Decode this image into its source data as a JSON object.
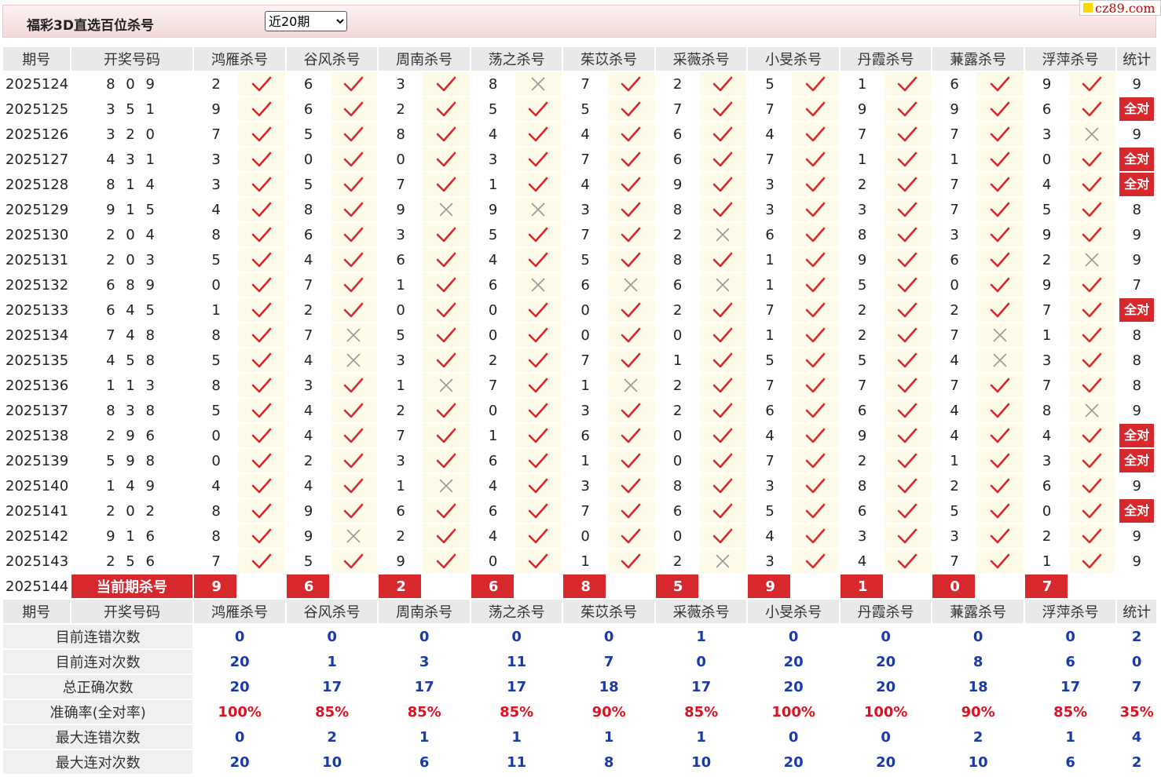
{
  "header": {
    "title": "福彩3D直选百位杀号",
    "period_selected": "近20期",
    "logo_text": "cz89.com"
  },
  "columns": {
    "issue": "期号",
    "draw": "开奖号码",
    "stat": "统计",
    "experts": [
      "鸿雁杀号",
      "谷风杀号",
      "周南杀号",
      "荡之杀号",
      "茱苡杀号",
      "采薇杀号",
      "小旻杀号",
      "丹霞杀号",
      "蒹露杀号",
      "浮萍杀号"
    ]
  },
  "rows": [
    {
      "issue": "2025124",
      "draw": "8 0 9",
      "picks": [
        2,
        6,
        3,
        8,
        7,
        2,
        5,
        1,
        6,
        9
      ],
      "ok": [
        1,
        1,
        1,
        0,
        1,
        1,
        1,
        1,
        1,
        1
      ],
      "stat": "9",
      "full": false
    },
    {
      "issue": "2025125",
      "draw": "3 5 1",
      "picks": [
        9,
        6,
        2,
        5,
        5,
        7,
        7,
        9,
        9,
        6
      ],
      "ok": [
        1,
        1,
        1,
        1,
        1,
        1,
        1,
        1,
        1,
        1
      ],
      "stat": "全对",
      "full": true
    },
    {
      "issue": "2025126",
      "draw": "3 2 0",
      "picks": [
        7,
        5,
        8,
        4,
        4,
        6,
        4,
        7,
        7,
        3
      ],
      "ok": [
        1,
        1,
        1,
        1,
        1,
        1,
        1,
        1,
        1,
        0
      ],
      "stat": "9",
      "full": false
    },
    {
      "issue": "2025127",
      "draw": "4 3 1",
      "picks": [
        3,
        0,
        0,
        3,
        7,
        6,
        7,
        1,
        1,
        0
      ],
      "ok": [
        1,
        1,
        1,
        1,
        1,
        1,
        1,
        1,
        1,
        1
      ],
      "stat": "全对",
      "full": true
    },
    {
      "issue": "2025128",
      "draw": "8 1 4",
      "picks": [
        3,
        5,
        7,
        1,
        4,
        9,
        3,
        2,
        7,
        4
      ],
      "ok": [
        1,
        1,
        1,
        1,
        1,
        1,
        1,
        1,
        1,
        1
      ],
      "stat": "全对",
      "full": true
    },
    {
      "issue": "2025129",
      "draw": "9 1 5",
      "picks": [
        4,
        8,
        9,
        9,
        3,
        8,
        3,
        3,
        7,
        5
      ],
      "ok": [
        1,
        1,
        0,
        0,
        1,
        1,
        1,
        1,
        1,
        1
      ],
      "stat": "8",
      "full": false
    },
    {
      "issue": "2025130",
      "draw": "2 0 4",
      "picks": [
        8,
        6,
        3,
        5,
        7,
        2,
        6,
        8,
        3,
        9
      ],
      "ok": [
        1,
        1,
        1,
        1,
        1,
        0,
        1,
        1,
        1,
        1
      ],
      "stat": "9",
      "full": false
    },
    {
      "issue": "2025131",
      "draw": "2 0 3",
      "picks": [
        5,
        4,
        6,
        4,
        5,
        8,
        1,
        9,
        6,
        2
      ],
      "ok": [
        1,
        1,
        1,
        1,
        1,
        1,
        1,
        1,
        1,
        0
      ],
      "stat": "9",
      "full": false
    },
    {
      "issue": "2025132",
      "draw": "6 8 9",
      "picks": [
        0,
        7,
        1,
        6,
        6,
        6,
        1,
        5,
        0,
        9
      ],
      "ok": [
        1,
        1,
        1,
        0,
        0,
        0,
        1,
        1,
        1,
        1
      ],
      "stat": "7",
      "full": false
    },
    {
      "issue": "2025133",
      "draw": "6 4 5",
      "picks": [
        1,
        2,
        0,
        0,
        0,
        2,
        7,
        2,
        2,
        7
      ],
      "ok": [
        1,
        1,
        1,
        1,
        1,
        1,
        1,
        1,
        1,
        1
      ],
      "stat": "全对",
      "full": true
    },
    {
      "issue": "2025134",
      "draw": "7 4 8",
      "picks": [
        8,
        7,
        5,
        0,
        0,
        0,
        1,
        2,
        7,
        1
      ],
      "ok": [
        1,
        0,
        1,
        1,
        1,
        1,
        1,
        1,
        0,
        1
      ],
      "stat": "8",
      "full": false
    },
    {
      "issue": "2025135",
      "draw": "4 5 8",
      "picks": [
        5,
        4,
        3,
        2,
        7,
        1,
        5,
        5,
        4,
        3
      ],
      "ok": [
        1,
        0,
        1,
        1,
        1,
        1,
        1,
        1,
        0,
        1
      ],
      "stat": "8",
      "full": false
    },
    {
      "issue": "2025136",
      "draw": "1 1 3",
      "picks": [
        8,
        3,
        1,
        7,
        1,
        2,
        7,
        7,
        7,
        7
      ],
      "ok": [
        1,
        1,
        0,
        1,
        0,
        1,
        1,
        1,
        1,
        1
      ],
      "stat": "8",
      "full": false
    },
    {
      "issue": "2025137",
      "draw": "8 3 8",
      "picks": [
        5,
        4,
        2,
        0,
        3,
        2,
        6,
        6,
        4,
        8
      ],
      "ok": [
        1,
        1,
        1,
        1,
        1,
        1,
        1,
        1,
        1,
        0
      ],
      "stat": "9",
      "full": false
    },
    {
      "issue": "2025138",
      "draw": "2 9 6",
      "picks": [
        0,
        4,
        7,
        1,
        6,
        0,
        4,
        9,
        4,
        4
      ],
      "ok": [
        1,
        1,
        1,
        1,
        1,
        1,
        1,
        1,
        1,
        1
      ],
      "stat": "全对",
      "full": true
    },
    {
      "issue": "2025139",
      "draw": "5 9 8",
      "picks": [
        0,
        2,
        3,
        6,
        1,
        0,
        7,
        2,
        1,
        3
      ],
      "ok": [
        1,
        1,
        1,
        1,
        1,
        1,
        1,
        1,
        1,
        1
      ],
      "stat": "全对",
      "full": true
    },
    {
      "issue": "2025140",
      "draw": "1 4 9",
      "picks": [
        4,
        4,
        1,
        4,
        3,
        8,
        3,
        8,
        2,
        6
      ],
      "ok": [
        1,
        1,
        0,
        1,
        1,
        1,
        1,
        1,
        1,
        1
      ],
      "stat": "9",
      "full": false
    },
    {
      "issue": "2025141",
      "draw": "2 0 2",
      "picks": [
        8,
        9,
        6,
        6,
        7,
        6,
        5,
        6,
        5,
        0
      ],
      "ok": [
        1,
        1,
        1,
        1,
        1,
        1,
        1,
        1,
        1,
        1
      ],
      "stat": "全对",
      "full": true
    },
    {
      "issue": "2025142",
      "draw": "9 1 6",
      "picks": [
        8,
        9,
        2,
        4,
        0,
        0,
        4,
        3,
        3,
        2
      ],
      "ok": [
        1,
        0,
        1,
        1,
        1,
        1,
        1,
        1,
        1,
        1
      ],
      "stat": "9",
      "full": false
    },
    {
      "issue": "2025143",
      "draw": "2 5 6",
      "picks": [
        7,
        5,
        9,
        0,
        1,
        2,
        3,
        4,
        7,
        1
      ],
      "ok": [
        1,
        1,
        1,
        1,
        1,
        0,
        1,
        1,
        1,
        1
      ],
      "stat": "9",
      "full": false
    }
  ],
  "current": {
    "issue": "2025144",
    "label": "当前期杀号",
    "picks": [
      9,
      6,
      2,
      6,
      8,
      5,
      9,
      1,
      0,
      7
    ]
  },
  "stats": [
    {
      "label": "目前连错次数",
      "values": [
        "0",
        "0",
        "0",
        "0",
        "0",
        "1",
        "0",
        "0",
        "0",
        "0"
      ],
      "total": "2",
      "rate": false
    },
    {
      "label": "目前连对次数",
      "values": [
        "20",
        "1",
        "3",
        "11",
        "7",
        "0",
        "20",
        "20",
        "8",
        "6"
      ],
      "total": "0",
      "rate": false
    },
    {
      "label": "总正确次数",
      "values": [
        "20",
        "17",
        "17",
        "17",
        "18",
        "17",
        "20",
        "20",
        "18",
        "17"
      ],
      "total": "7",
      "rate": false
    },
    {
      "label": "准确率(全对率)",
      "values": [
        "100%",
        "85%",
        "85%",
        "85%",
        "90%",
        "85%",
        "100%",
        "100%",
        "90%",
        "85%"
      ],
      "total": "35%",
      "rate": true
    },
    {
      "label": "最大连错次数",
      "values": [
        "0",
        "2",
        "1",
        "1",
        "1",
        "1",
        "0",
        "0",
        "2",
        "1"
      ],
      "total": "4",
      "rate": false
    },
    {
      "label": "最大连对次数",
      "values": [
        "20",
        "10",
        "6",
        "11",
        "8",
        "10",
        "20",
        "20",
        "10",
        "6"
      ],
      "total": "2",
      "rate": false
    }
  ],
  "colors": {
    "accent": "#d7282d",
    "check": "#d7282d",
    "cross": "#999999",
    "stat_value": "#1a3aa6"
  }
}
